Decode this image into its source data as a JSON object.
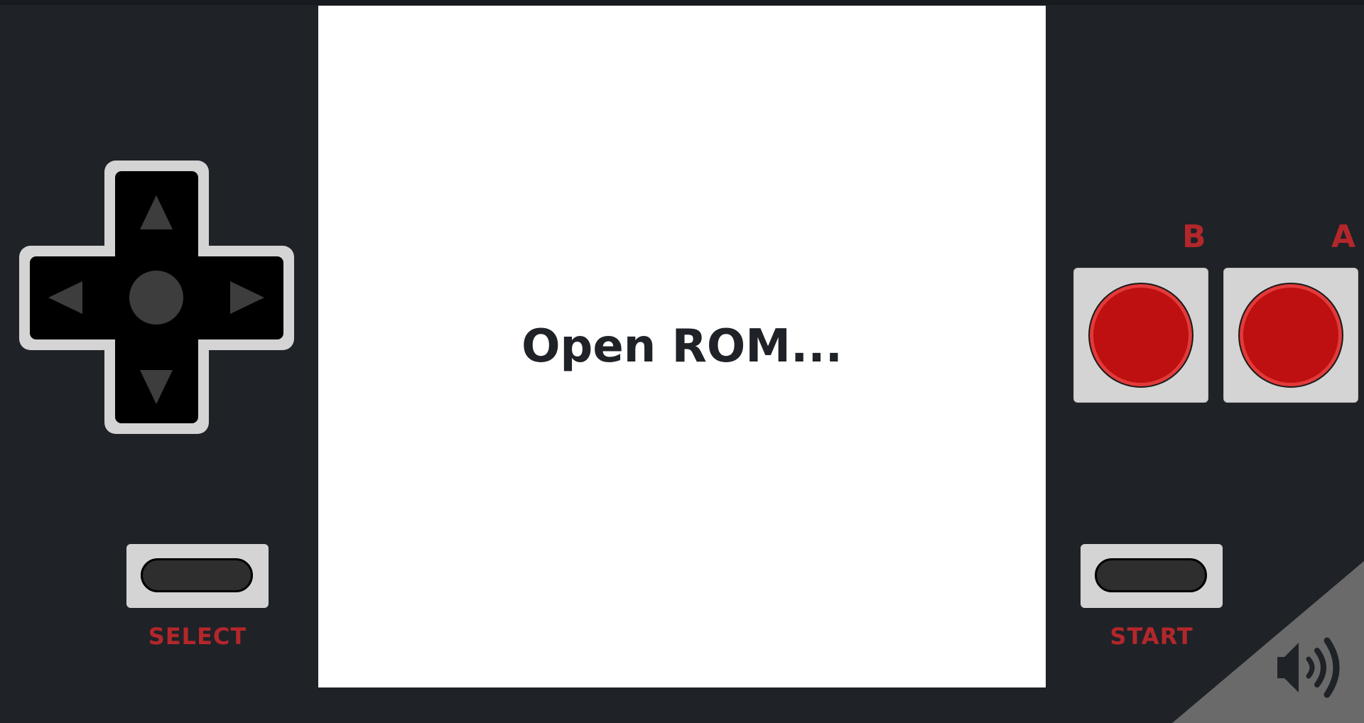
{
  "screen": {
    "prompt": "Open ROM..."
  },
  "buttons": {
    "b_label": "B",
    "a_label": "A",
    "select_label": "SELECT",
    "start_label": "START"
  },
  "icons": {
    "dpad_up": "triangle-up-icon",
    "dpad_down": "triangle-down-icon",
    "dpad_left": "triangle-left-icon",
    "dpad_right": "triangle-right-icon",
    "sound": "speaker-volume-icon"
  },
  "colors": {
    "background": "#1f2227",
    "screen": "#ffffff",
    "accent_red": "#b3272b",
    "button_red": "#be1010",
    "pad_gray": "#d4d4d4",
    "corner_gray": "#6a6a6a"
  }
}
